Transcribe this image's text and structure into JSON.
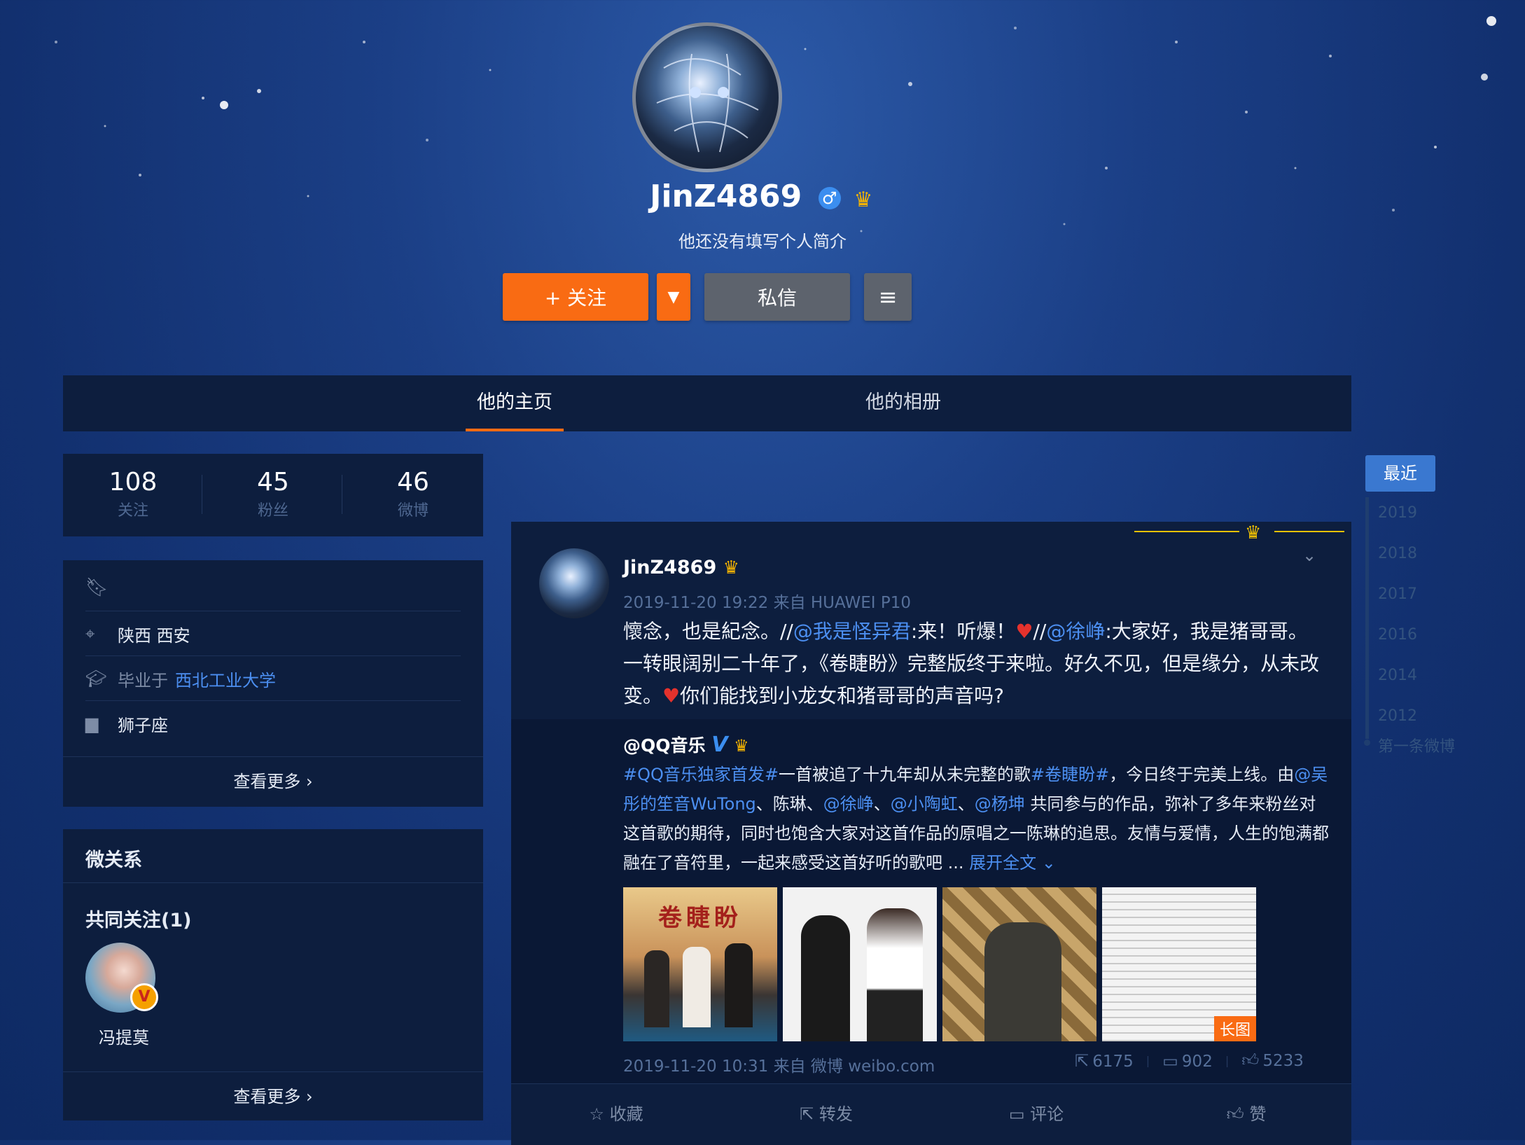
{
  "profile": {
    "username": "JinZ4869",
    "gender_icon": "male-icon",
    "bio": "他还没有填写个人简介",
    "follow_label": "+ 关注",
    "message_label": "私信"
  },
  "tabs": [
    {
      "label": "他的主页",
      "active": true
    },
    {
      "label": "他的相册",
      "active": false
    }
  ],
  "stats": [
    {
      "value": "108",
      "label": "关注"
    },
    {
      "value": "45",
      "label": "粉丝"
    },
    {
      "value": "46",
      "label": "微博"
    }
  ],
  "info": {
    "location": "陕西 西安",
    "education_prefix": "毕业于",
    "school": "西北工业大学",
    "zodiac": "狮子座",
    "more_label": "查看更多 ›"
  },
  "relations": {
    "title": "微关系",
    "common_title": "共同关注(1)",
    "friend_name": "冯提莫",
    "more_label": "查看更多 ›"
  },
  "post": {
    "author": "JinZ4869",
    "meta": "2019-11-20 19:22 来自 HUAWEI P10",
    "text_1": "懷念，也是紀念。//",
    "mention_1": "@我是怪异君",
    "text_2": ":来！听爆！",
    "text_3": "//",
    "mention_2": "@徐峥",
    "text_4": ":大家好，我是猪哥哥。一转眼阔别二十年了，《卷睫盼》完整版终于来啦。好久不见，但是缘分，从未改变。",
    "text_5": "你们能找到小龙女和猪哥哥的声音吗?"
  },
  "repost": {
    "author": "@QQ音乐",
    "hashtag_1": "#QQ音乐独家首发#",
    "text_1": "一首被追了十九年却从未完整的歌",
    "hashtag_2": "#卷睫盼#",
    "text_2": "，今日终于完美上线。由",
    "mention_1": "@吴彤的笙音WuTong",
    "text_3": "、陈琳、",
    "mention_2": "@徐峥",
    "sep_1": "、",
    "mention_3": "@小陶虹",
    "sep_2": "、",
    "mention_4": "@杨坤",
    "text_4": " 共同参与的作品，弥补了多年来粉丝对这首歌的期待，同时也饱含大家对这首作品的原唱之一陈琳的追思。友情与爱情，人生的饱满都融在了音符里，一起来感受这首好听的歌吧 ... ",
    "expand_label": "展开全文 ⌄",
    "image_1_title": "卷睫盼",
    "long_image_tag": "长图",
    "meta": "2019-11-20 10:31 来自 微博 weibo.com",
    "reposts": "6175",
    "comments": "902",
    "likes": "5233"
  },
  "actions": [
    {
      "label": "收藏",
      "icon": "star-icon"
    },
    {
      "label": "转发",
      "icon": "share-icon"
    },
    {
      "label": "评论",
      "icon": "comment-icon"
    },
    {
      "label": "赞",
      "icon": "thumb-up-icon"
    }
  ],
  "timeline": {
    "recent": "最近",
    "years": [
      "2019",
      "2018",
      "2017",
      "2016",
      "2014",
      "2012"
    ],
    "first": "第一条微博"
  },
  "colors": {
    "accent": "#f96b13",
    "link": "#4c8ff1",
    "panel": "#0d1e3e"
  }
}
